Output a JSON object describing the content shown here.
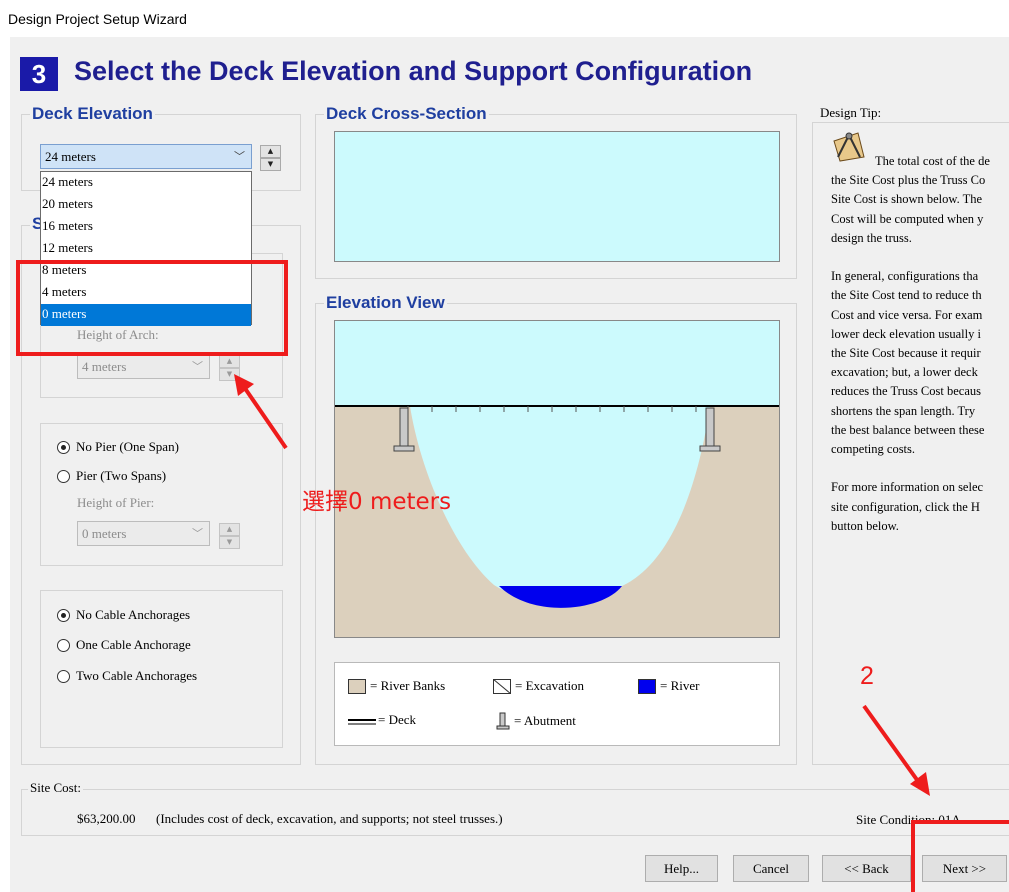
{
  "window": {
    "title": "Design Project Setup Wizard"
  },
  "header": {
    "step": "3",
    "title": "Select the Deck Elevation and Support Configuration"
  },
  "deck_elevation": {
    "title": "Deck Elevation",
    "selected": "24 meters",
    "options": [
      "24 meters",
      "20 meters",
      "16 meters",
      "12 meters",
      "8 meters",
      "4 meters",
      "0 meters"
    ],
    "highlighted": "0 meters"
  },
  "support": {
    "title_partial": "S",
    "arch_height_label": "Height of Arch:",
    "arch_height_value": "4 meters",
    "pier_options": [
      "No Pier (One Span)",
      "Pier (Two Spans)"
    ],
    "pier_height_label": "Height of Pier:",
    "pier_height_value": "0 meters",
    "cable_options": [
      "No Cable Anchorages",
      "One Cable Anchorage",
      "Two Cable Anchorages"
    ]
  },
  "cross_section": {
    "title": "Deck Cross-Section"
  },
  "elevation_view": {
    "title": "Elevation View"
  },
  "legend": {
    "river_banks": "= River Banks",
    "excavation": "= Excavation",
    "river": "= River",
    "deck": "= Deck",
    "abutment": "= Abutment"
  },
  "design_tip": {
    "label": "Design Tip:",
    "lines": [
      "The total cost of the de",
      "the Site Cost plus the Truss Co",
      "Site Cost is shown below. The",
      "Cost will be computed when y",
      "design the truss.",
      "",
      "In general, configurations tha",
      "the Site Cost tend to reduce th",
      "Cost and vice versa. For exam",
      "lower deck elevation usually i",
      "the Site Cost because it requir",
      "excavation; but, a lower deck",
      "reduces the Truss Cost becaus",
      "shortens the span length. Try",
      "the best balance between these",
      "competing costs.",
      "",
      "For more information on selec",
      "site configuration, click the H",
      "button below."
    ]
  },
  "site_cost": {
    "label": "Site Cost:",
    "value": "$63,200.00",
    "note": "(Includes cost of deck, excavation, and supports; not steel trusses.)",
    "condition": "Site Condition: 01A"
  },
  "buttons": {
    "help": "Help...",
    "cancel": "Cancel",
    "back": "<< Back",
    "next": "Next >>"
  },
  "annotations": {
    "instruction": "選擇0 meters",
    "step_number": "2"
  },
  "colors": {
    "sky": "#ccfafd",
    "bank": "#dcd0bd",
    "river": "#0000ee",
    "heading": "#1f1f8f",
    "badge": "#1a1aa8",
    "annotation": "#ee1c1c",
    "selection": "#0078d7"
  }
}
